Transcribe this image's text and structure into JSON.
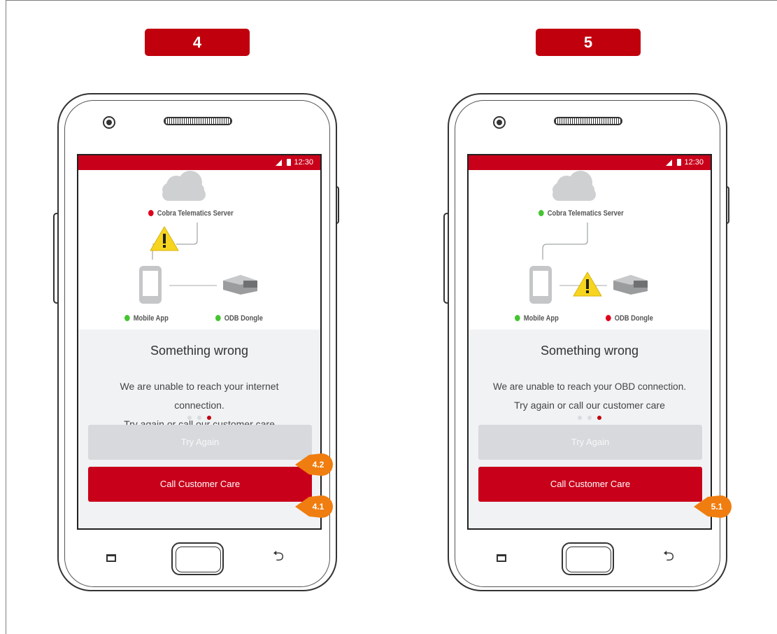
{
  "panels": [
    {
      "step": "4",
      "status_time": "12:30",
      "diagram": {
        "server_label": "Cobra Telematics Server",
        "app_label": "Mobile App",
        "dongle_label": "ODB Dongle"
      },
      "title": "Something wrong",
      "message_lines": [
        "We are unable to reach your internet",
        "connection.",
        "Try again or call our customer care"
      ],
      "try_again_label": "Try Again",
      "call_label": "Call Customer Care",
      "callout_try": "4.2",
      "callout_call": "4.1"
    },
    {
      "step": "5",
      "status_time": "12:30",
      "diagram": {
        "server_label": "Cobra Telematics Server",
        "app_label": "Mobile App",
        "dongle_label": "ODB Dongle"
      },
      "title": "Something wrong",
      "message_lines": [
        "We are unable to reach your OBD connection.",
        "Try again or call our customer care"
      ],
      "try_again_label": "Try Again",
      "call_label": "Call Customer Care",
      "callout_call": "5.1"
    }
  ],
  "colors": {
    "brand_red": "#c9001a",
    "badge_red": "#c0000d",
    "status_error": "#e0001b",
    "status_ok": "#43c52f",
    "callout_orange": "#f07d0f"
  }
}
